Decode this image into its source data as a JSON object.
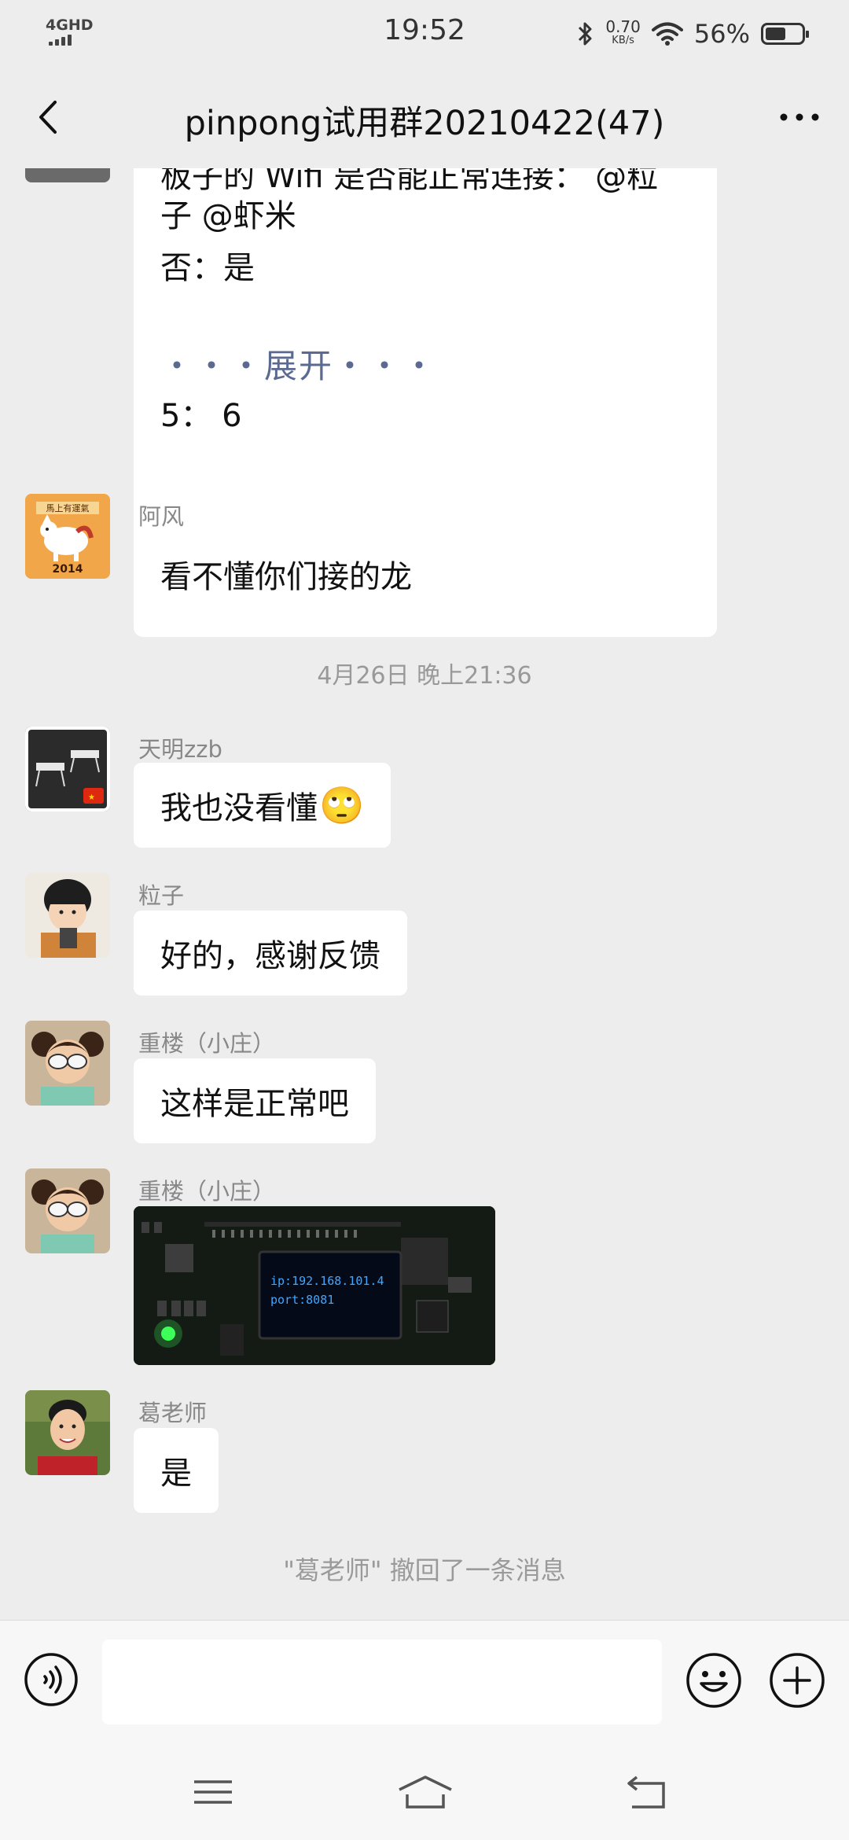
{
  "status_bar": {
    "network": "4GHD",
    "time": "19:52",
    "speed_value": "0.70",
    "speed_unit": "KB/s",
    "battery_percent": "56%",
    "battery_level": 0.56
  },
  "header": {
    "back_icon": "chevron-left-icon",
    "title": "pinpong试用群20210422(47)",
    "more_icon": "more-horizontal-icon"
  },
  "messages": {
    "long_message": {
      "line1": "板子的 Wifi 是否能正常连接：  @粒",
      "line2": "子  @虾米",
      "line3": "否：是",
      "expand": "・・・展开・・・",
      "line4": "5：  6"
    },
    "m1": {
      "sender": "阿风",
      "text": "看不懂你们接的龙"
    },
    "timestamp": "4月26日 晚上21:36",
    "m2": {
      "sender": "天明zzb",
      "text": "我也没看懂",
      "emoji": "🙄"
    },
    "m3": {
      "sender": "粒子",
      "text": "好的，感谢反馈"
    },
    "m4": {
      "sender": "重楼（小庄）",
      "text": "这样是正常吧"
    },
    "m5": {
      "sender": "重楼（小庄）",
      "image_line1": "ip:192.168.101.4",
      "image_line2": "port:8081"
    },
    "m6": {
      "sender": "葛老师",
      "text": "是"
    },
    "system_notice": "\"葛老师\" 撤回了一条消息"
  },
  "avatar_m1_text_top": "馬上有運氣",
  "avatar_m1_text_bottom": "2014",
  "input_bar": {
    "voice_icon": "voice-icon",
    "input_value": "",
    "emoji_icon": "emoji-icon",
    "plus_icon": "plus-circle-icon"
  },
  "system_nav": {
    "menu_icon": "menu-icon",
    "home_icon": "home-icon",
    "back_icon": "back-icon"
  },
  "colors": {
    "background": "#ededed",
    "bubble": "#ffffff",
    "link_blue": "#5b6a91",
    "meta_gray": "#888888"
  }
}
